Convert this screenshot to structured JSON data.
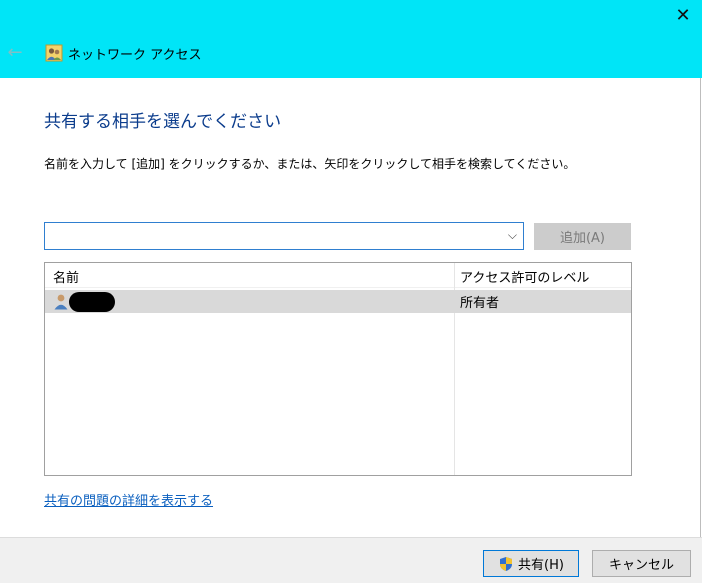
{
  "window": {
    "title": "ネットワーク アクセス",
    "back_glyph": "←",
    "close_glyph": "✕"
  },
  "main": {
    "heading": "共有する相手を選んでください",
    "instruction": "名前を入力して [追加] をクリックするか、または、矢印をクリックして相手を検索してください。",
    "combo": {
      "value": "",
      "chevron_glyph": "⌵"
    },
    "add_button_label": "追加(A)",
    "list": {
      "columns": [
        "名前",
        "アクセス許可のレベル"
      ],
      "rows": [
        {
          "name": "",
          "level": "所有者"
        }
      ]
    },
    "details_link": "共有の問題の詳細を表示する"
  },
  "footer": {
    "share_label": "共有(H)",
    "cancel_label": "キャンセル"
  },
  "colors": {
    "titlebar": "#00e5f7",
    "heading": "#0b3c8c",
    "link": "#0a5fbf",
    "focus_border": "#2f7fd0",
    "selected_row": "#d9d9d9"
  }
}
